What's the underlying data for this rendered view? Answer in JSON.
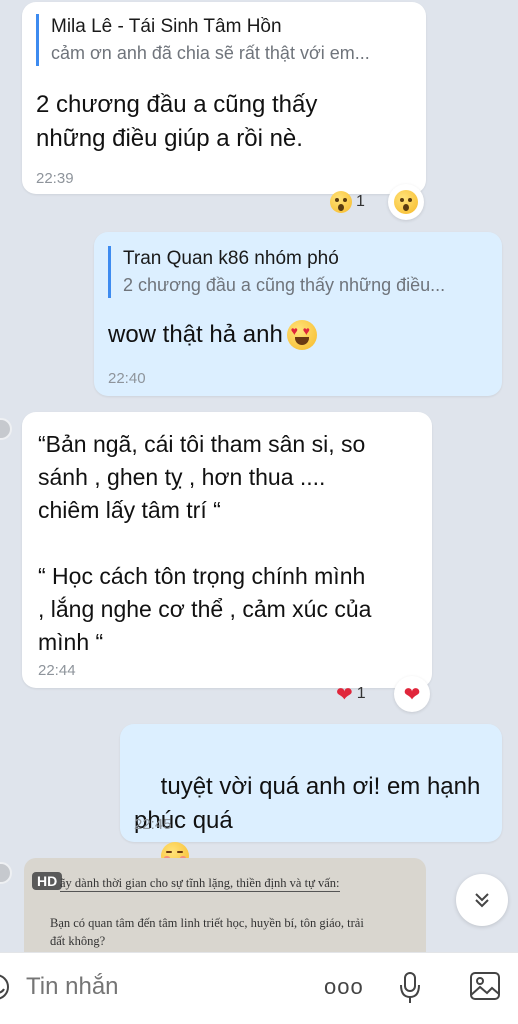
{
  "messages": [
    {
      "quote": {
        "name": "Mila Lê - Tái Sinh Tâm Hồn",
        "text": "cảm ơn anh đã chia sẽ rất thật với em..."
      },
      "text": "2 chương đầu a cũng thấy\nnhững điều giúp a rồi nè.",
      "time": "22:39",
      "reaction": {
        "type": "wow",
        "count": "1"
      }
    },
    {
      "quote": {
        "name": "Tran Quan k86 nhóm phó",
        "text": "2 chương đầu a cũng thấy những điều..."
      },
      "text": "wow thật hả anh",
      "emoji": "heart-eyes",
      "time": "22:40"
    },
    {
      "text": "“Bản ngã, cái tôi tham sân si, so\nsánh , ghen tỵ , hơn thua ....\nchiêm lấy tâm trí “\n\n“ Học cách tôn trọng chính mình\n, lắng nghe cơ thể , cảm xúc của\nmình “",
      "time": "22:44",
      "reaction": {
        "type": "heart",
        "count": "1"
      }
    },
    {
      "text": "tuyệt vời quá anh ơi! em hạnh\nphúc quá",
      "emoji": "blush",
      "time": "22:45"
    }
  ],
  "image_preview": {
    "badge": "HD",
    "line1": "ãy dành thời gian cho sự tĩnh lặng, thiền định và tự vấn:",
    "line2": "Bạn có quan tâm đến tâm linh triết học, huyền bí, tôn giáo, trải",
    "line3": "đất không?"
  },
  "composer": {
    "placeholder": "Tin nhắn",
    "more_label": "ooo"
  }
}
